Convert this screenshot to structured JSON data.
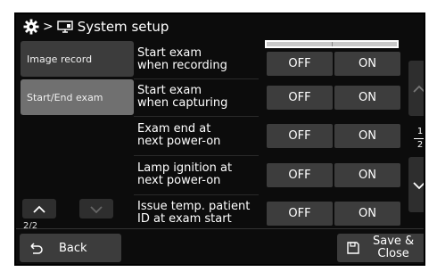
{
  "title": {
    "separator": ">",
    "label": "System setup"
  },
  "sidebar": {
    "items": [
      {
        "label": "Image record",
        "active": false
      },
      {
        "label": "Start/End exam",
        "active": true
      }
    ],
    "page_indicator": "2/2"
  },
  "settings": [
    {
      "label_line1": "Start exam",
      "label_line2": "when recording",
      "off": "OFF",
      "on": "ON"
    },
    {
      "label_line1": "Start exam",
      "label_line2": "when capturing",
      "off": "OFF",
      "on": "ON"
    },
    {
      "label_line1": "Exam end at",
      "label_line2": "next power-on",
      "off": "OFF",
      "on": "ON"
    },
    {
      "label_line1": "Lamp ignition at",
      "label_line2": "next power-on",
      "off": "OFF",
      "on": "ON"
    },
    {
      "label_line1": "Issue temp. patient",
      "label_line2": "ID at exam start",
      "off": "OFF",
      "on": "ON"
    }
  ],
  "pager": {
    "current": "1",
    "total": "2"
  },
  "footer": {
    "back_label": "Back",
    "save_line1": "Save &",
    "save_line2": "Close"
  },
  "icons": [
    "gear-icon",
    "monitor-icon",
    "chevron-up-icon",
    "chevron-down-icon",
    "back-arrow-icon",
    "floppy-disk-icon"
  ]
}
